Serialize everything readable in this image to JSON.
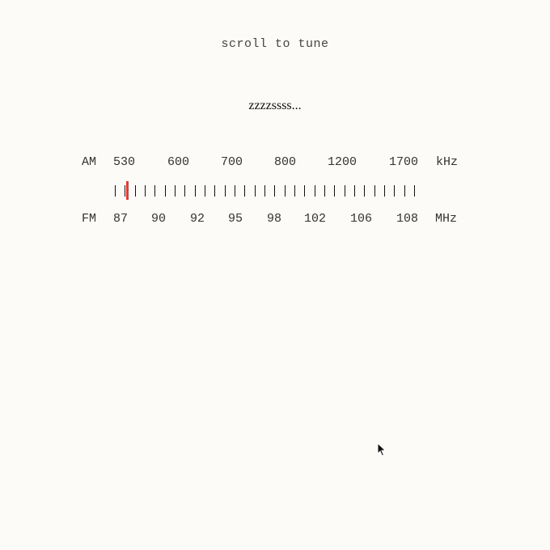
{
  "hint": "scroll to tune",
  "station_status": "zzzzssss...",
  "am": {
    "band": "AM",
    "unit": "kHz",
    "frequencies": [
      "530",
      "600",
      "700",
      "800",
      "1200",
      "1700"
    ]
  },
  "fm": {
    "band": "FM",
    "unit": "MHz",
    "frequencies": [
      "87",
      "90",
      "92",
      "95",
      "98",
      "102",
      "106",
      "108"
    ]
  },
  "tuner": {
    "tick_count": 31,
    "needle_position_fraction": 0.04,
    "needle_color": "#e53935"
  },
  "icons": {
    "cursor": "arrow-pointer-icon"
  }
}
